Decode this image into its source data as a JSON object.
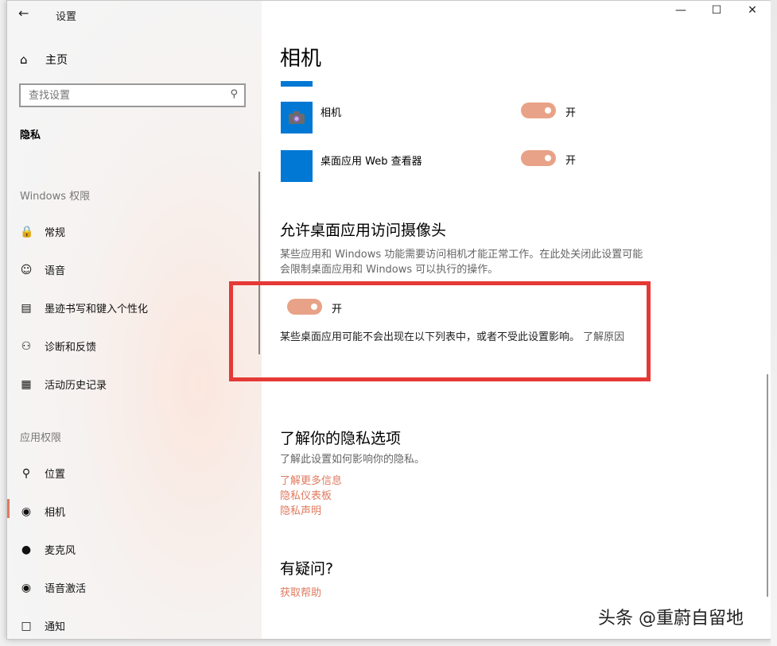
{
  "window": {
    "title": "设置"
  },
  "sidebar": {
    "home": "主页",
    "search_placeholder": "查找设置",
    "section": "隐私",
    "groups": [
      {
        "label": "Windows 权限"
      },
      {
        "label": "应用权限"
      }
    ],
    "items": [
      {
        "label": "常规",
        "icon": "lock-icon"
      },
      {
        "label": "语音",
        "icon": "speech-icon"
      },
      {
        "label": "墨迹书写和键入个性化",
        "icon": "clipboard-icon"
      },
      {
        "label": "诊断和反馈",
        "icon": "feedback-icon"
      },
      {
        "label": "活动历史记录",
        "icon": "timeline-icon"
      },
      {
        "label": "位置",
        "icon": "location-icon"
      },
      {
        "label": "相机",
        "icon": "camera-icon",
        "selected": true
      },
      {
        "label": "麦克风",
        "icon": "microphone-icon"
      },
      {
        "label": "语音激活",
        "icon": "voice-activation-icon"
      },
      {
        "label": "通知",
        "icon": "notification-icon"
      }
    ]
  },
  "main": {
    "title": "相机",
    "apps": [
      {
        "name": "相机",
        "state": "开",
        "on": true
      },
      {
        "name": "桌面应用 Web 查看器",
        "state": "开",
        "on": true
      }
    ],
    "desktop_section": {
      "heading": "允许桌面应用访问摄像头",
      "description": "某些应用和 Windows 功能需要访问相机才能正常工作。在此处关闭此设置可能会限制桌面应用和 Windows 可以执行的操作。",
      "toggle_state": "开",
      "note": "某些桌面应用可能不会出现在以下列表中，或者不受此设置影响。",
      "note_link": "了解原因"
    },
    "privacy_section": {
      "heading": "了解你的隐私选项",
      "description": "了解此设置如何影响你的隐私。",
      "links": [
        "了解更多信息",
        "隐私仪表板",
        "隐私声明"
      ]
    },
    "help_section": {
      "heading": "有疑问?",
      "link": "获取帮助"
    }
  },
  "watermark": "头条 @重蔚自留地",
  "colors": {
    "accent": "#e07a5f",
    "toggle_on": "#e8a287",
    "tile": "#0078d4",
    "highlight_box": "#e53935"
  }
}
